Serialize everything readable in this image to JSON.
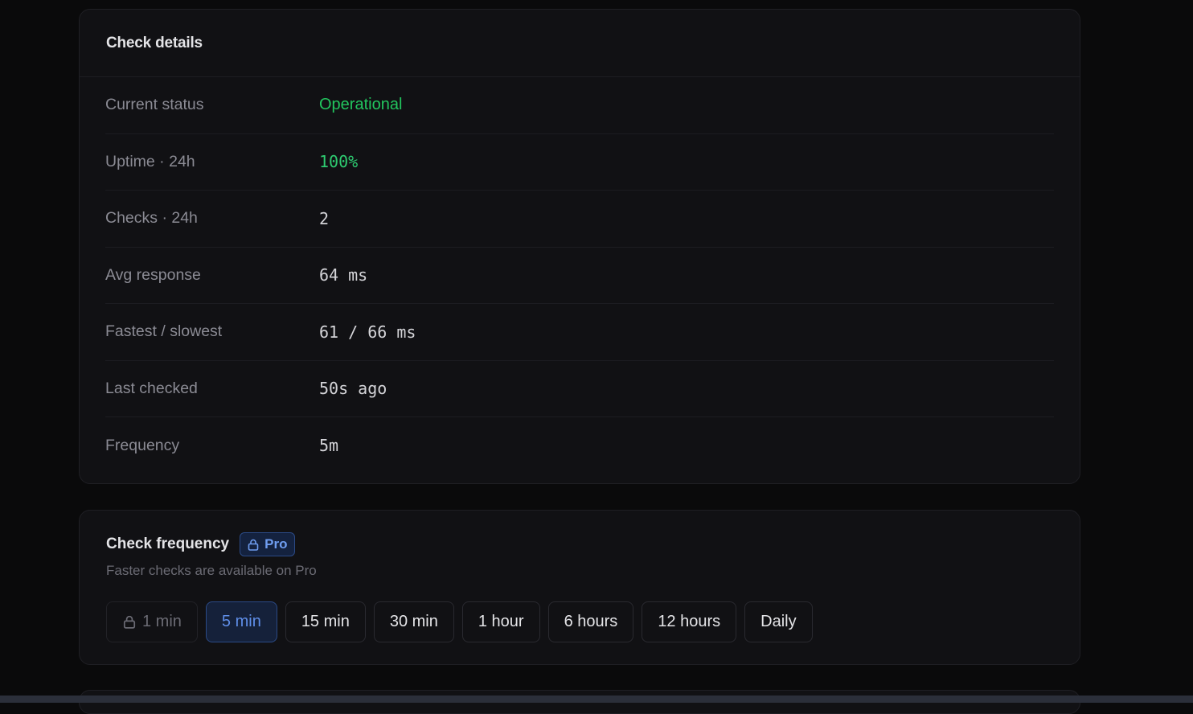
{
  "details": {
    "title": "Check details",
    "rows": [
      {
        "label": "Current status",
        "value": "Operational"
      },
      {
        "label": "Uptime · 24h",
        "value": "100%"
      },
      {
        "label": "Checks · 24h",
        "value": "2"
      },
      {
        "label": "Avg response",
        "value": "64 ms"
      },
      {
        "label": "Fastest / slowest",
        "value": "61 / 66 ms"
      },
      {
        "label": "Last checked",
        "value": "50s ago"
      },
      {
        "label": "Frequency",
        "value": "5m"
      }
    ]
  },
  "frequency": {
    "title": "Check frequency",
    "badge": "Pro",
    "badge_icon": "lock-icon",
    "subtitle": "Faster checks are available on Pro",
    "options": [
      {
        "label": "1 min",
        "locked": true,
        "selected": false
      },
      {
        "label": "5 min",
        "locked": false,
        "selected": true
      },
      {
        "label": "15 min",
        "locked": false,
        "selected": false
      },
      {
        "label": "30 min",
        "locked": false,
        "selected": false
      },
      {
        "label": "1 hour",
        "locked": false,
        "selected": false
      },
      {
        "label": "6 hours",
        "locked": false,
        "selected": false
      },
      {
        "label": "12 hours",
        "locked": false,
        "selected": false
      },
      {
        "label": "Daily",
        "locked": false,
        "selected": false
      }
    ]
  },
  "colors": {
    "status_green": "#22c55e",
    "accent_blue": "#5f8ee8",
    "background": "#0a0a0b",
    "card": "#111114"
  }
}
